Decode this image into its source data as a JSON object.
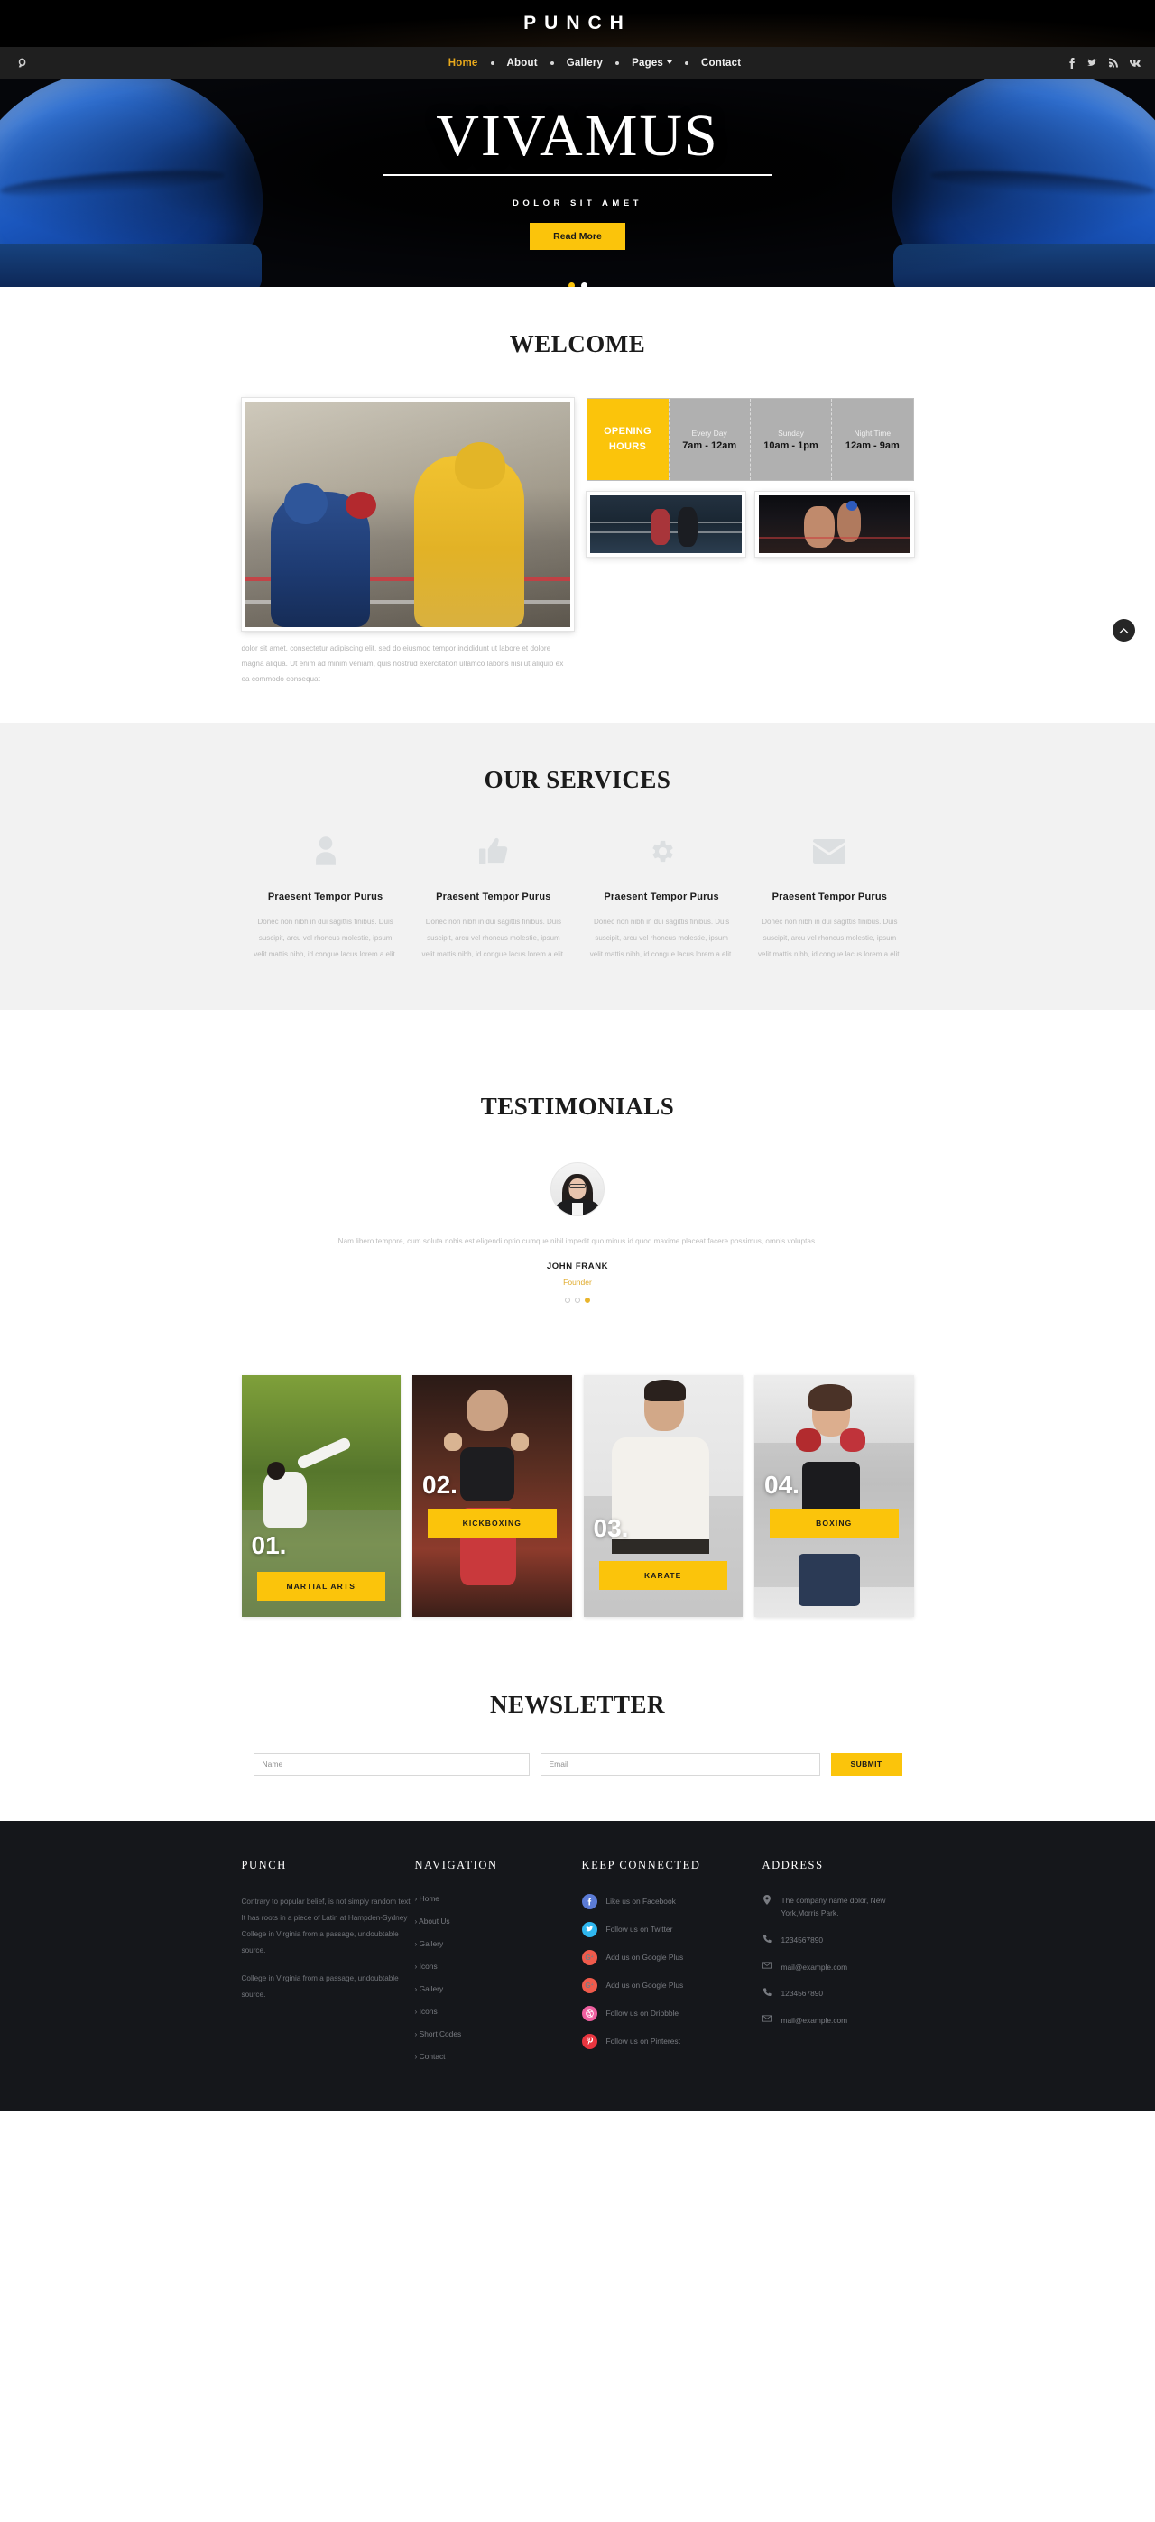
{
  "brand": {
    "name": "PUNCH",
    "logo_icon": "punch-logo-icon"
  },
  "nav": {
    "items": [
      {
        "label": "Home",
        "active": true
      },
      {
        "label": "About",
        "active": false
      },
      {
        "label": "Gallery",
        "active": false
      },
      {
        "label": "Pages",
        "active": false,
        "has_dropdown": true
      },
      {
        "label": "Contact",
        "active": false
      }
    ],
    "social": [
      {
        "name": "facebook-icon"
      },
      {
        "name": "twitter-icon"
      },
      {
        "name": "rss-icon"
      },
      {
        "name": "vk-icon"
      }
    ]
  },
  "hero": {
    "title": "VIVAMUS",
    "subtitle": "DOLOR SIT AMET",
    "button": "Read More",
    "slides": 2,
    "active_slide": 0
  },
  "welcome": {
    "title": "WELCOME",
    "caption": "dolor sit amet, consectetur adipiscing elit, sed do eiusmod tempor incididunt ut labore et dolore magna aliqua. Ut enim ad minim veniam, quis nostrud exercitation ullamco laboris nisi ut aliquip ex ea commodo consequat",
    "hours": {
      "label_line1": "OPENING",
      "label_line2": "HOURS",
      "columns": [
        {
          "day": "Every Day",
          "time": "7am - 12am"
        },
        {
          "day": "Sunday",
          "time": "10am - 1pm"
        },
        {
          "day": "Night Time",
          "time": "12am - 9am"
        }
      ]
    }
  },
  "services": {
    "title": "OUR SERVICES",
    "items": [
      {
        "icon": "user-icon",
        "title": "Praesent Tempor Purus",
        "text": "Donec non nibh in dui sagittis finibus. Duis suscipit, arcu vel rhoncus molestie, ipsum velit mattis nibh, id congue lacus lorem a elit."
      },
      {
        "icon": "thumbs-up-icon",
        "title": "Praesent Tempor Purus",
        "text": "Donec non nibh in dui sagittis finibus. Duis suscipit, arcu vel rhoncus molestie, ipsum velit mattis nibh, id congue lacus lorem a elit."
      },
      {
        "icon": "gear-icon",
        "title": "Praesent Tempor Purus",
        "text": "Donec non nibh in dui sagittis finibus. Duis suscipit, arcu vel rhoncus molestie, ipsum velit mattis nibh, id congue lacus lorem a elit."
      },
      {
        "icon": "envelope-icon",
        "title": "Praesent Tempor Purus",
        "text": "Donec non nibh in dui sagittis finibus. Duis suscipit, arcu vel rhoncus molestie, ipsum velit mattis nibh, id congue lacus lorem a elit."
      }
    ]
  },
  "testimonials": {
    "title": "TESTIMONIALS",
    "quote": "Nam libero tempore, cum soluta nobis est eligendi optio cumque nihil impedit quo minus id quod maxime placeat facere possimus, omnis voluptas.",
    "name": "JOHN FRANK",
    "role": "Founder",
    "slides": 3,
    "active_slide": 2
  },
  "classes": {
    "items": [
      {
        "number": "01.",
        "label": "MARTIAL ARTS"
      },
      {
        "number": "02.",
        "label": "KICKBOXING"
      },
      {
        "number": "03.",
        "label": "KARATE"
      },
      {
        "number": "04.",
        "label": "BOXING"
      }
    ]
  },
  "newsletter": {
    "title": "NEWSLETTER",
    "name_placeholder": "Name",
    "email_placeholder": "Email",
    "submit_label": "SUBMIT"
  },
  "footer": {
    "about": {
      "heading": "PUNCH",
      "paragraph1": "Contrary to popular belief, is not simply random text. It has roots in a piece of Latin at Hampden-Sydney College in Virginia from a passage, undoubtable source.",
      "paragraph2": "College in Virginia from a passage, undoubtable source."
    },
    "navigation": {
      "heading": "NAVIGATION",
      "links": [
        "Home",
        "About Us",
        "Gallery",
        "Icons",
        "Gallery",
        "Icons",
        "Short Codes",
        "Contact"
      ]
    },
    "connected": {
      "heading": "KEEP CONNECTED",
      "items": [
        {
          "label": "Like us on Facebook",
          "icon": "facebook-icon",
          "color": "#5b7bd5"
        },
        {
          "label": "Follow us on Twitter",
          "icon": "twitter-icon",
          "color": "#2fb7ef"
        },
        {
          "label": "Add us on Google Plus",
          "icon": "google-plus-icon",
          "color": "#ef5b4c"
        },
        {
          "label": "Add us on Google Plus",
          "icon": "google-plus-icon",
          "color": "#ef5b4c"
        },
        {
          "label": "Follow us on Dribbble",
          "icon": "dribbble-icon",
          "color": "#ef5fa0"
        },
        {
          "label": "Follow us on Pinterest",
          "icon": "pinterest-icon",
          "color": "#e8353f"
        }
      ]
    },
    "address": {
      "heading": "ADDRESS",
      "rows": [
        {
          "icon": "map-pin-icon",
          "text": "The company name dolor, New York,Morris Park."
        },
        {
          "icon": "phone-icon",
          "text": "1234567890"
        },
        {
          "icon": "envelope-icon",
          "text": "mail@example.com"
        },
        {
          "icon": "phone-icon",
          "text": "1234567890"
        },
        {
          "icon": "envelope-icon",
          "text": "mail@example.com"
        }
      ]
    }
  },
  "scroll_top": {
    "icon": "chevron-up-icon"
  },
  "colors": {
    "accent": "#fbc40b",
    "dark": "#15171b",
    "nav": "#1f1f1f"
  }
}
